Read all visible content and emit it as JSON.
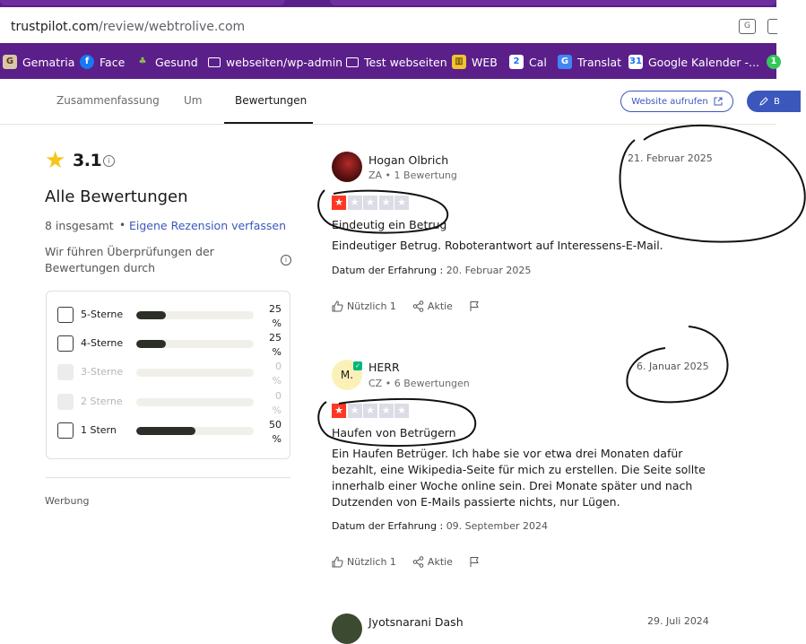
{
  "browser": {
    "url_host": "trustpilot.com",
    "url_path": "/review/webtrolive.com",
    "bookmarks": [
      {
        "label": "Gematria",
        "icon": "gematria-icon"
      },
      {
        "label": "Face",
        "icon": "facebook-icon"
      },
      {
        "label": "Gesund",
        "icon": "leaf-icon"
      },
      {
        "label": "webseiten/wp-admin",
        "icon": "folder-icon"
      },
      {
        "label": "Test webseiten",
        "icon": "folder-icon"
      },
      {
        "label": "WEB",
        "icon": "bank-icon"
      },
      {
        "label": "Cal",
        "icon": "calendar-icon"
      },
      {
        "label": "Translat",
        "icon": "translate-icon"
      },
      {
        "label": "Google Kalender -...",
        "icon": "google-calendar-icon"
      }
    ],
    "bm_badge": "1"
  },
  "tabs": {
    "summary": "Zusammenfassung",
    "about": "Um",
    "reviews": "Bewertungen",
    "website_btn": "Website aufrufen",
    "write_btn": "B"
  },
  "rating": {
    "score": "3.1",
    "info": "i",
    "title": "Alle Bewertungen",
    "total": "8 insgesamt",
    "dot": "•",
    "write_link": "Eigene Rezension verfassen",
    "verify_text": "Wir führen Überprüfungen der Bewertungen durch",
    "verify_info": "i",
    "distribution": [
      {
        "label": "5-Sterne",
        "percent": 25,
        "pct_top": "25",
        "pct_bottom": "%",
        "disabled": false
      },
      {
        "label": "4-Sterne",
        "percent": 25,
        "pct_top": "25",
        "pct_bottom": "%",
        "disabled": false
      },
      {
        "label": "3-Sterne",
        "percent": 0,
        "pct_top": "0",
        "pct_bottom": "%",
        "disabled": true
      },
      {
        "label": "2 Sterne",
        "percent": 0,
        "pct_top": "0",
        "pct_bottom": "%",
        "disabled": true
      },
      {
        "label": "1 Stern",
        "percent": 50,
        "pct_top": "50",
        "pct_bottom": "%",
        "disabled": false
      }
    ],
    "ads": "Werbung"
  },
  "reviews": [
    {
      "name": "Hogan Olbrich",
      "meta": "ZA • 1 Bewertung",
      "date": "21. Februar 2025",
      "stars": 1,
      "title": "Eindeutig ein Betrug",
      "body": "Eindeutiger Betrug. Roboterantwort auf Interessens-E-Mail.",
      "exp_label": "Datum der Erfahrung :",
      "exp_value": "20. Februar 2025",
      "useful": "Nützlich 1",
      "share": "Aktie"
    },
    {
      "name": "HERR",
      "initials": "M.",
      "meta": "CZ • 6 Bewertungen",
      "date": "6. Januar 2025",
      "stars": 1,
      "title": "Haufen von Betrügern",
      "body": "Ein Haufen Betrüger. Ich habe sie vor etwa drei Monaten dafür bezahlt, eine Wikipedia-Seite für mich zu erstellen. Die Seite sollte innerhalb einer Woche online sein. Drei Monate später und nach Dutzenden von E-Mails passierte nichts, nur Lügen.",
      "exp_label": "Datum der Erfahrung :",
      "exp_value": "09. September 2024",
      "useful": "Nützlich 1",
      "share": "Aktie"
    },
    {
      "name": "Jyotsnarani Dash",
      "date": "29. Juli 2024"
    }
  ],
  "colors": {
    "brand_purple": "#5b1f8a",
    "trustpilot_blue": "#3c57bc",
    "star_red": "#ff3722",
    "star_yellow": "#f5c518",
    "bar_dark": "#2b2f28"
  }
}
